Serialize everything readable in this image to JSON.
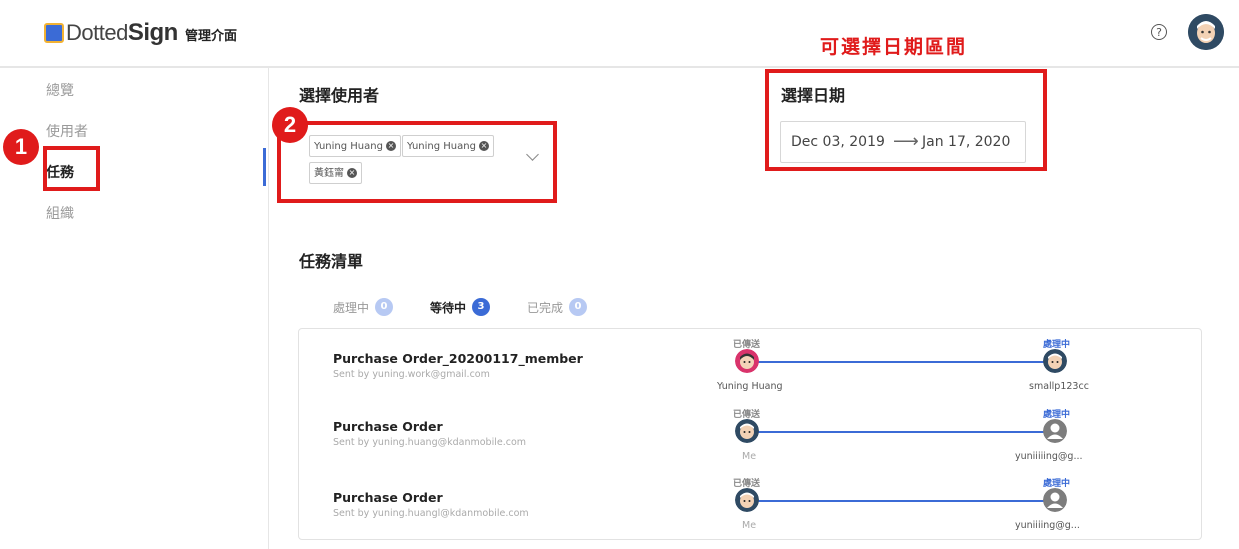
{
  "header": {
    "brand_light": "Dotted",
    "brand_bold": "Sign",
    "admin_title": "管理介面",
    "callout": "可選擇日期區間",
    "help_glyph": "?"
  },
  "sidebar": {
    "items": [
      {
        "label": "總覽"
      },
      {
        "label": "使用者"
      },
      {
        "label": "任務"
      },
      {
        "label": "組織"
      }
    ]
  },
  "annotations": {
    "badge1": "1",
    "badge2": "2"
  },
  "user_select": {
    "title": "選擇使用者",
    "chips": [
      "Yuning Huang",
      "Yuning Huang",
      "黃鈺甯"
    ],
    "remove_glyph": "×"
  },
  "date_select": {
    "title": "選擇日期",
    "start": "Dec 03, 2019",
    "arrow": "⟶",
    "end": "Jan 17, 2020"
  },
  "task_list": {
    "title": "任務清單",
    "tabs": [
      {
        "label": "處理中",
        "count": "0"
      },
      {
        "label": "等待中",
        "count": "3"
      },
      {
        "label": "已完成",
        "count": "0"
      }
    ],
    "rows": [
      {
        "name": "Purchase Order_20200117_member",
        "sender": "Sent by yuning.work@gmail.com",
        "from_status": "已傳送",
        "from_label": "Yuning Huang",
        "to_status": "處理中",
        "to_label": "smallp123cc"
      },
      {
        "name": "Purchase Order",
        "sender": "Sent by yuning.huang@kdanmobile.com",
        "from_status": "已傳送",
        "from_label": "Me",
        "to_status": "處理中",
        "to_label": "yuniiiiing@g..."
      },
      {
        "name": "Purchase Order",
        "sender": "Sent by yuning.huangl@kdanmobile.com",
        "from_status": "已傳送",
        "from_label": "Me",
        "to_status": "處理中",
        "to_label": "yuniiiing@g..."
      }
    ]
  },
  "colors": {
    "accent": "#3b6bd6",
    "annotation_red": "#e01b1b"
  }
}
